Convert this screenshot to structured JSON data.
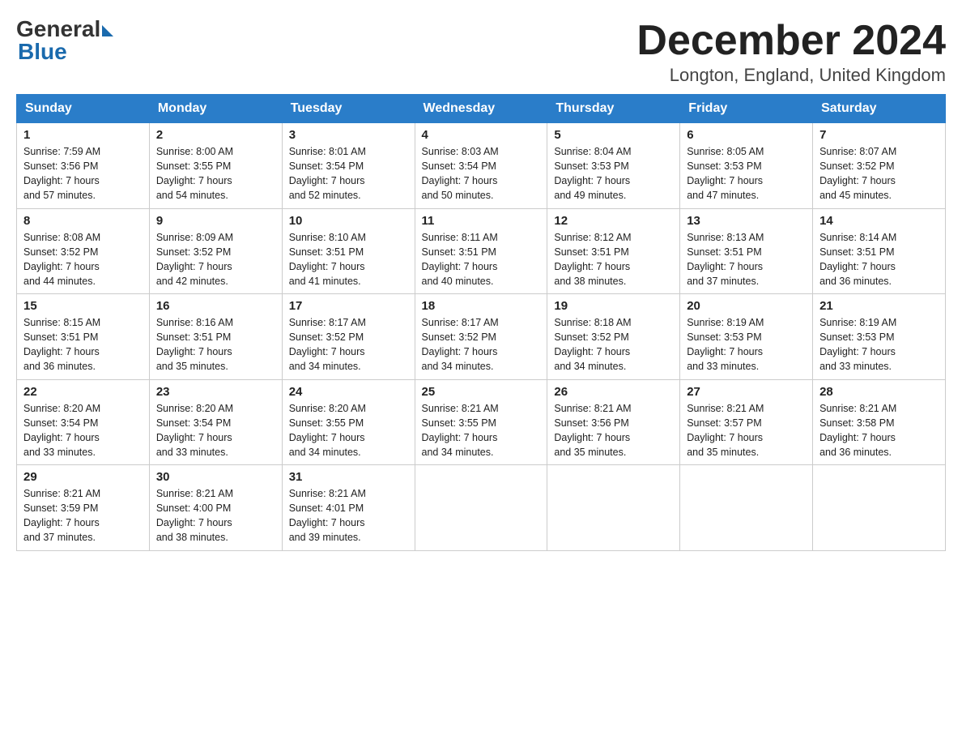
{
  "logo": {
    "general": "General",
    "blue": "Blue"
  },
  "title": "December 2024",
  "location": "Longton, England, United Kingdom",
  "days_header": [
    "Sunday",
    "Monday",
    "Tuesday",
    "Wednesday",
    "Thursday",
    "Friday",
    "Saturday"
  ],
  "weeks": [
    [
      {
        "num": "1",
        "info": "Sunrise: 7:59 AM\nSunset: 3:56 PM\nDaylight: 7 hours\nand 57 minutes."
      },
      {
        "num": "2",
        "info": "Sunrise: 8:00 AM\nSunset: 3:55 PM\nDaylight: 7 hours\nand 54 minutes."
      },
      {
        "num": "3",
        "info": "Sunrise: 8:01 AM\nSunset: 3:54 PM\nDaylight: 7 hours\nand 52 minutes."
      },
      {
        "num": "4",
        "info": "Sunrise: 8:03 AM\nSunset: 3:54 PM\nDaylight: 7 hours\nand 50 minutes."
      },
      {
        "num": "5",
        "info": "Sunrise: 8:04 AM\nSunset: 3:53 PM\nDaylight: 7 hours\nand 49 minutes."
      },
      {
        "num": "6",
        "info": "Sunrise: 8:05 AM\nSunset: 3:53 PM\nDaylight: 7 hours\nand 47 minutes."
      },
      {
        "num": "7",
        "info": "Sunrise: 8:07 AM\nSunset: 3:52 PM\nDaylight: 7 hours\nand 45 minutes."
      }
    ],
    [
      {
        "num": "8",
        "info": "Sunrise: 8:08 AM\nSunset: 3:52 PM\nDaylight: 7 hours\nand 44 minutes."
      },
      {
        "num": "9",
        "info": "Sunrise: 8:09 AM\nSunset: 3:52 PM\nDaylight: 7 hours\nand 42 minutes."
      },
      {
        "num": "10",
        "info": "Sunrise: 8:10 AM\nSunset: 3:51 PM\nDaylight: 7 hours\nand 41 minutes."
      },
      {
        "num": "11",
        "info": "Sunrise: 8:11 AM\nSunset: 3:51 PM\nDaylight: 7 hours\nand 40 minutes."
      },
      {
        "num": "12",
        "info": "Sunrise: 8:12 AM\nSunset: 3:51 PM\nDaylight: 7 hours\nand 38 minutes."
      },
      {
        "num": "13",
        "info": "Sunrise: 8:13 AM\nSunset: 3:51 PM\nDaylight: 7 hours\nand 37 minutes."
      },
      {
        "num": "14",
        "info": "Sunrise: 8:14 AM\nSunset: 3:51 PM\nDaylight: 7 hours\nand 36 minutes."
      }
    ],
    [
      {
        "num": "15",
        "info": "Sunrise: 8:15 AM\nSunset: 3:51 PM\nDaylight: 7 hours\nand 36 minutes."
      },
      {
        "num": "16",
        "info": "Sunrise: 8:16 AM\nSunset: 3:51 PM\nDaylight: 7 hours\nand 35 minutes."
      },
      {
        "num": "17",
        "info": "Sunrise: 8:17 AM\nSunset: 3:52 PM\nDaylight: 7 hours\nand 34 minutes."
      },
      {
        "num": "18",
        "info": "Sunrise: 8:17 AM\nSunset: 3:52 PM\nDaylight: 7 hours\nand 34 minutes."
      },
      {
        "num": "19",
        "info": "Sunrise: 8:18 AM\nSunset: 3:52 PM\nDaylight: 7 hours\nand 34 minutes."
      },
      {
        "num": "20",
        "info": "Sunrise: 8:19 AM\nSunset: 3:53 PM\nDaylight: 7 hours\nand 33 minutes."
      },
      {
        "num": "21",
        "info": "Sunrise: 8:19 AM\nSunset: 3:53 PM\nDaylight: 7 hours\nand 33 minutes."
      }
    ],
    [
      {
        "num": "22",
        "info": "Sunrise: 8:20 AM\nSunset: 3:54 PM\nDaylight: 7 hours\nand 33 minutes."
      },
      {
        "num": "23",
        "info": "Sunrise: 8:20 AM\nSunset: 3:54 PM\nDaylight: 7 hours\nand 33 minutes."
      },
      {
        "num": "24",
        "info": "Sunrise: 8:20 AM\nSunset: 3:55 PM\nDaylight: 7 hours\nand 34 minutes."
      },
      {
        "num": "25",
        "info": "Sunrise: 8:21 AM\nSunset: 3:55 PM\nDaylight: 7 hours\nand 34 minutes."
      },
      {
        "num": "26",
        "info": "Sunrise: 8:21 AM\nSunset: 3:56 PM\nDaylight: 7 hours\nand 35 minutes."
      },
      {
        "num": "27",
        "info": "Sunrise: 8:21 AM\nSunset: 3:57 PM\nDaylight: 7 hours\nand 35 minutes."
      },
      {
        "num": "28",
        "info": "Sunrise: 8:21 AM\nSunset: 3:58 PM\nDaylight: 7 hours\nand 36 minutes."
      }
    ],
    [
      {
        "num": "29",
        "info": "Sunrise: 8:21 AM\nSunset: 3:59 PM\nDaylight: 7 hours\nand 37 minutes."
      },
      {
        "num": "30",
        "info": "Sunrise: 8:21 AM\nSunset: 4:00 PM\nDaylight: 7 hours\nand 38 minutes."
      },
      {
        "num": "31",
        "info": "Sunrise: 8:21 AM\nSunset: 4:01 PM\nDaylight: 7 hours\nand 39 minutes."
      },
      null,
      null,
      null,
      null
    ]
  ]
}
